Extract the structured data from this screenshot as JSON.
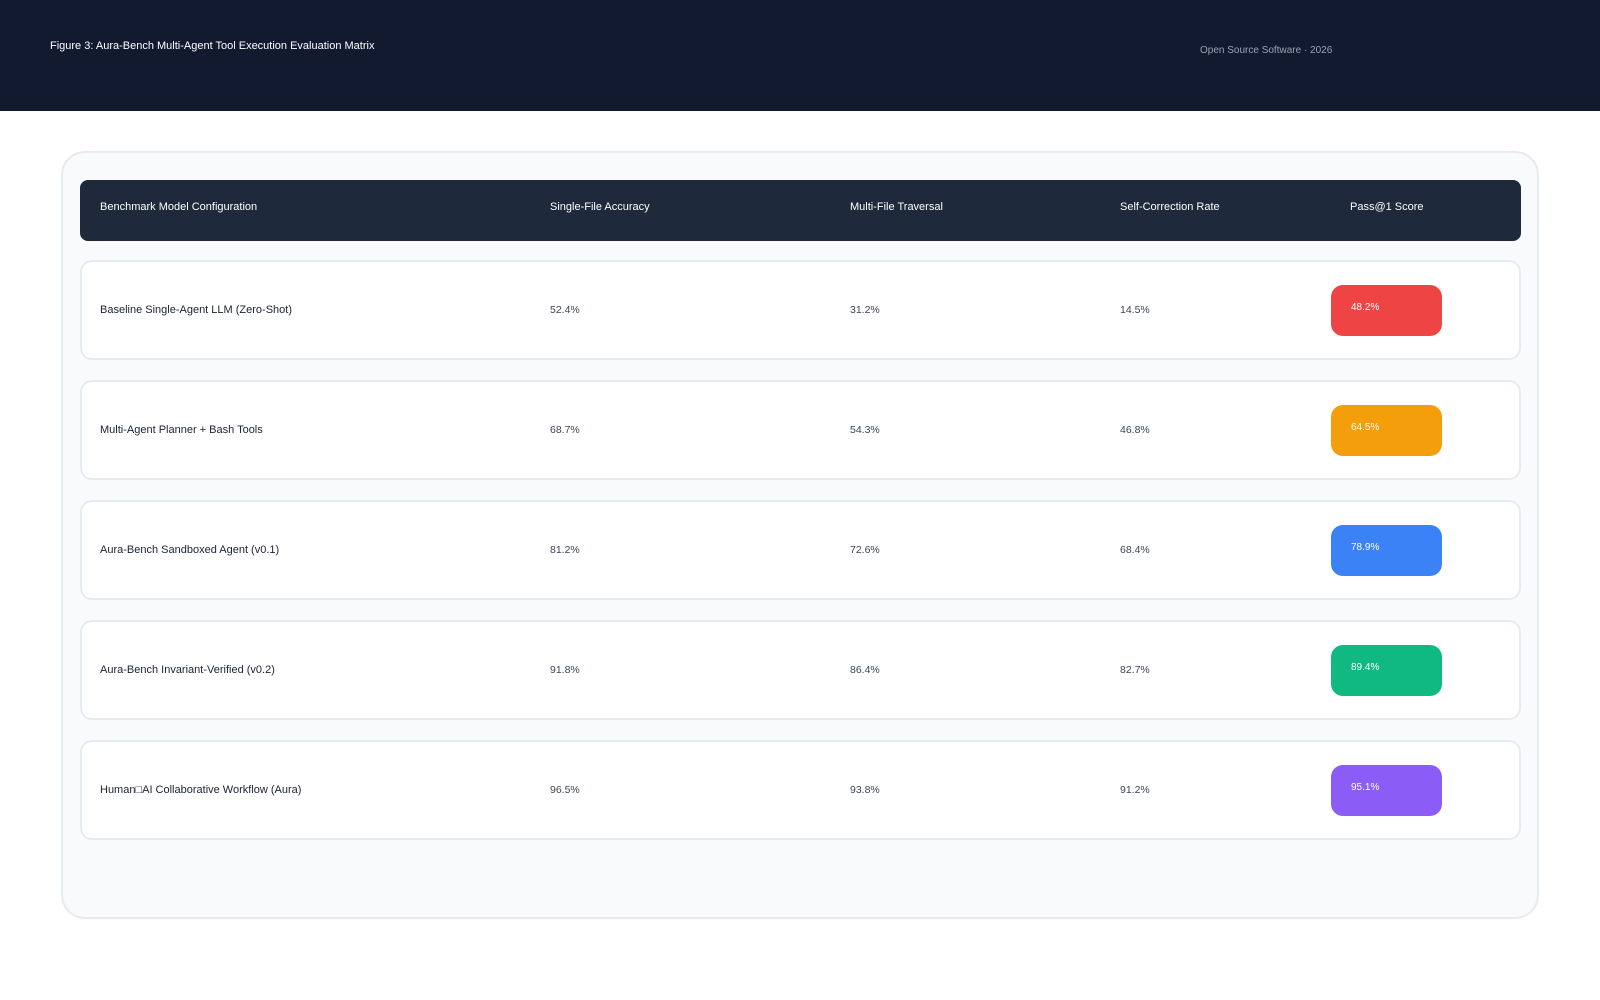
{
  "header": {
    "title": "Figure 3: Aura-Bench Multi-Agent Tool Execution Evaluation Matrix",
    "subtitle": "Open Source Software · 2026"
  },
  "chart_data": {
    "type": "table",
    "columns": [
      "Benchmark Model Configuration",
      "Single-File Accuracy",
      "Multi-File Traversal",
      "Self-Correction Rate",
      "Pass@1 Score"
    ],
    "rows": [
      {
        "config": "Baseline Single-Agent LLM (Zero-Shot)",
        "single_file": "52.4%",
        "multi_file": "31.2%",
        "self_correction": "14.5%",
        "pass1": "48.2%",
        "pass1_color": "#ef4444"
      },
      {
        "config": "Multi-Agent Planner + Bash Tools",
        "single_file": "68.7%",
        "multi_file": "54.3%",
        "self_correction": "46.8%",
        "pass1": "64.5%",
        "pass1_color": "#f59e0b"
      },
      {
        "config": "Aura-Bench Sandboxed Agent (v0.1)",
        "single_file": "81.2%",
        "multi_file": "72.6%",
        "self_correction": "68.4%",
        "pass1": "78.9%",
        "pass1_color": "#3b82f6"
      },
      {
        "config": "Aura-Bench Invariant-Verified (v0.2)",
        "single_file": "91.8%",
        "multi_file": "86.4%",
        "self_correction": "82.7%",
        "pass1": "89.4%",
        "pass1_color": "#10b981"
      },
      {
        "config": "Human□AI Collaborative Workflow (Aura)",
        "single_file": "96.5%",
        "multi_file": "93.8%",
        "self_correction": "91.2%",
        "pass1": "95.1%",
        "pass1_color": "#8b5cf6"
      }
    ]
  }
}
